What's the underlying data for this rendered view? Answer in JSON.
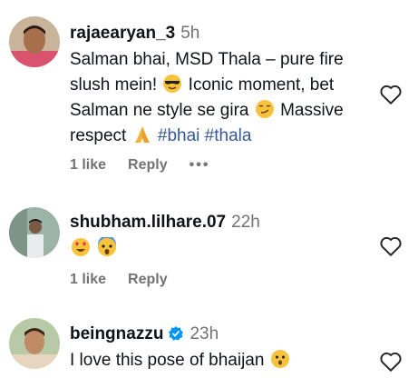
{
  "comments": [
    {
      "username": "rajaearyan_3",
      "time": "5h",
      "verified": false,
      "text_parts": [
        "Salman bhai, MSD Thala – pure fire slush mein!",
        "Iconic moment, bet Salman ne style se gira",
        "Massive respect"
      ],
      "hashtags": [
        "#bhai",
        "#thala"
      ],
      "emojis": [
        "cool-sunglasses-emoji",
        "smirk-emoji",
        "folded-hands-emoji"
      ],
      "likes": "1 like",
      "reply": "Reply",
      "more": "•••"
    },
    {
      "username": "shubham.lilhare.07",
      "time": "22h",
      "verified": false,
      "emojis": [
        "heart-eyes-emoji",
        "screaming-emoji"
      ],
      "likes": "1 like",
      "reply": "Reply"
    },
    {
      "username": "beingnazzu",
      "time": "23h",
      "verified": true,
      "text": "I love this pose of bhaijan",
      "emojis": [
        "hushed-emoji"
      ]
    }
  ],
  "colors": {
    "muted": "#737373",
    "hashtag": "#385898",
    "verified": "#0095f6"
  }
}
